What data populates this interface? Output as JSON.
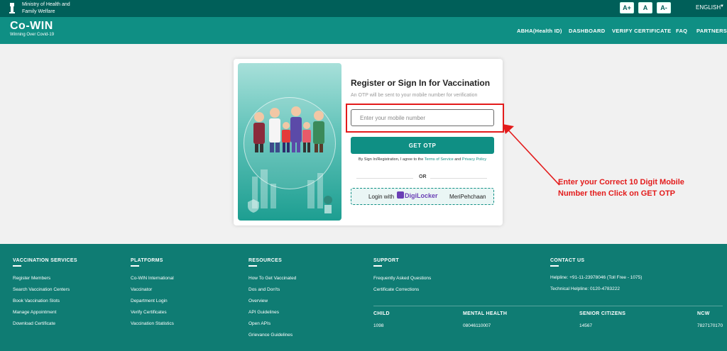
{
  "gov": {
    "ministry_line1": "Ministry of Health and",
    "ministry_line2": "Family Welfare",
    "font_buttons": [
      "A+",
      "A",
      "A-"
    ],
    "language": "ENGLISH"
  },
  "header": {
    "logo": "Co-WIN",
    "tagline": "Winning Over Covid-19",
    "nav": [
      "ABHA(Health ID)",
      "DASHBOARD",
      "VERIFY CERTIFICATE",
      "FAQ",
      "PARTNERS"
    ]
  },
  "login": {
    "title": "Register or Sign In for Vaccination",
    "subtitle": "An OTP will be sent to your mobile number for verification",
    "mobile_placeholder": "Enter your mobile number",
    "get_otp": "GET OTP",
    "terms_prefix": "By Sign In/Registration, I agree to the",
    "terms_link": "Terms of Service",
    "terms_and": "and",
    "privacy_link": "Privacy Policy",
    "or": "OR",
    "digi_prefix": "Login with",
    "digi_brand": "DigiLocker",
    "digi_suffix": "MeriPehchaan"
  },
  "annotation": {
    "line1": "Enter your Correct 10 Digit Mobile",
    "line2": "Number then Click on GET OTP"
  },
  "footer": {
    "vaccination_services": {
      "title": "VACCINATION SERVICES",
      "items": [
        "Register Members",
        "Search Vaccination Centers",
        "Book Vaccination Slots",
        "Manage Appointment",
        "Download Certificate"
      ]
    },
    "platforms": {
      "title": "PLATFORMS",
      "items": [
        "Co-WIN International",
        "Vaccinator",
        "Department Login",
        "Verify Certificates",
        "Vaccination Statistics"
      ]
    },
    "resources": {
      "title": "RESOURCES",
      "items": [
        "How To Get Vaccinated",
        "Dos and Don'ts",
        "Overview",
        "API Guidelines",
        "Open APIs",
        "Grievance Guidelines"
      ]
    },
    "support": {
      "title": "SUPPORT",
      "items": [
        "Frequently Asked Questions",
        "Certificate Corrections"
      ]
    },
    "contact": {
      "title": "CONTACT US",
      "helpline": "Helpline: +91-11-23978046 (Toll Free - 1075)",
      "technical": "Technical Helpline: 0120-4783222"
    },
    "helplines": [
      {
        "label": "CHILD",
        "number": "1098"
      },
      {
        "label": "MENTAL HEALTH",
        "number": "08046110007"
      },
      {
        "label": "SENIOR CITIZENS",
        "number": "14567"
      },
      {
        "label": "NCW",
        "number": "7827170170"
      }
    ]
  },
  "colors": {
    "gov_bar": "#005f59",
    "header": "#0f8f84",
    "footer": "#0f7c73",
    "annotation": "#e31b1b"
  }
}
